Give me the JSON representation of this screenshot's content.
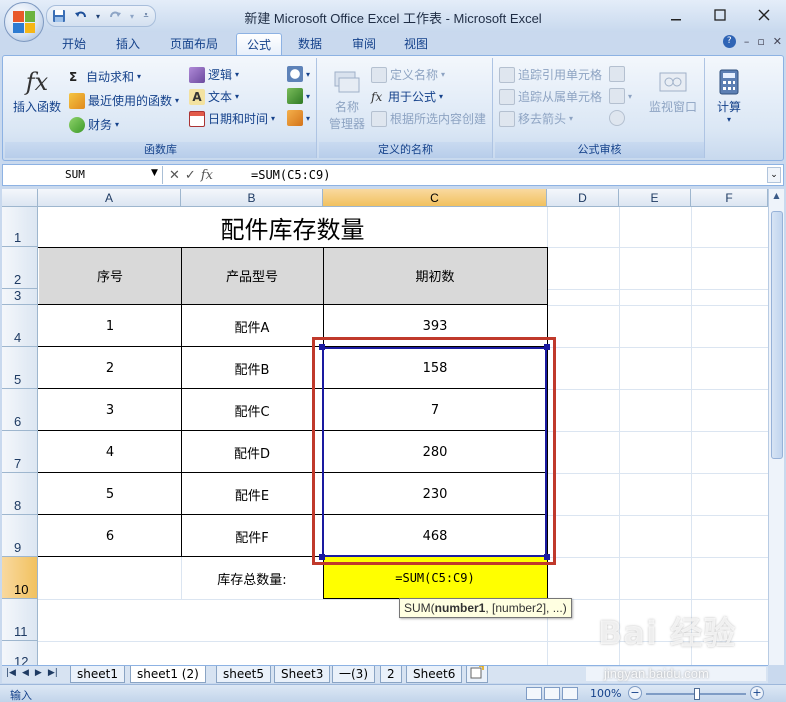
{
  "window": {
    "title": "新建 Microsoft Office Excel 工作表 - Microsoft Excel",
    "controls": [
      "minimize",
      "maximize",
      "close"
    ]
  },
  "quick_access": {
    "icons": [
      "save-icon",
      "undo-icon",
      "redo-icon",
      "customize-icon"
    ]
  },
  "ribbon": {
    "tabs": [
      "开始",
      "插入",
      "页面布局",
      "公式",
      "数据",
      "审阅",
      "视图"
    ],
    "active_tab": "公式",
    "groups": {
      "function_library": {
        "label": "函数库",
        "insert_function": "插入函数",
        "autosum": "自动求和",
        "recent": "最近使用的函数",
        "financial": "财务",
        "logical": "逻辑",
        "text": "文本",
        "datetime": "日期和时间"
      },
      "defined_names": {
        "label": "定义的名称",
        "name_manager_1": "名称",
        "name_manager_2": "管理器",
        "define_name": "定义名称",
        "use_in_formula": "用于公式",
        "create_from_selection": "根据所选内容创建"
      },
      "formula_auditing": {
        "label": "公式审核",
        "trace_precedents": "追踪引用单元格",
        "trace_dependents": "追踪从属单元格",
        "remove_arrows": "移去箭头",
        "watch_window": "监视窗口"
      },
      "calculation": {
        "label": "计算"
      }
    }
  },
  "formula_bar": {
    "name_box": "SUM",
    "formula": "=SUM(C5:C9)"
  },
  "columns": [
    "A",
    "B",
    "C",
    "D",
    "E",
    "F"
  ],
  "selected_column": "C",
  "rows": [
    "1",
    "2",
    "3",
    "4",
    "5",
    "6",
    "7",
    "8",
    "9",
    "10",
    "11",
    "12"
  ],
  "selected_row": "10",
  "sheet": {
    "title": "配件库存数量",
    "headers": [
      "序号",
      "产品型号",
      "期初数"
    ],
    "data": [
      {
        "no": "1",
        "model": "配件A",
        "qty": "393"
      },
      {
        "no": "2",
        "model": "配件B",
        "qty": "158"
      },
      {
        "no": "3",
        "model": "配件C",
        "qty": "7"
      },
      {
        "no": "4",
        "model": "配件D",
        "qty": "280"
      },
      {
        "no": "5",
        "model": "配件E",
        "qty": "230"
      },
      {
        "no": "6",
        "model": "配件F",
        "qty": "468"
      }
    ],
    "total_label": "库存总数量:",
    "total_formula": "=SUM(C5:C9)"
  },
  "tooltip": {
    "fn": "SUM(",
    "arg1": "number1",
    "rest": ", [number2], ...)"
  },
  "sheet_tabs": [
    "sheet1",
    "sheet1 (2)",
    "sheet5",
    "Sheet3",
    "一(3)",
    "2",
    "Sheet6"
  ],
  "active_sheet": "sheet1 (2)",
  "status": {
    "mode": "输入",
    "zoom": "100%"
  },
  "watermark": {
    "text": "Bai 经验",
    "url": "jingyan.baidu.com"
  },
  "colors": {
    "selection_border": "#1a1aa0",
    "highlight_border": "#c0392b",
    "header_fill": "#d9d9d9",
    "total_fill": "#ffff00"
  }
}
